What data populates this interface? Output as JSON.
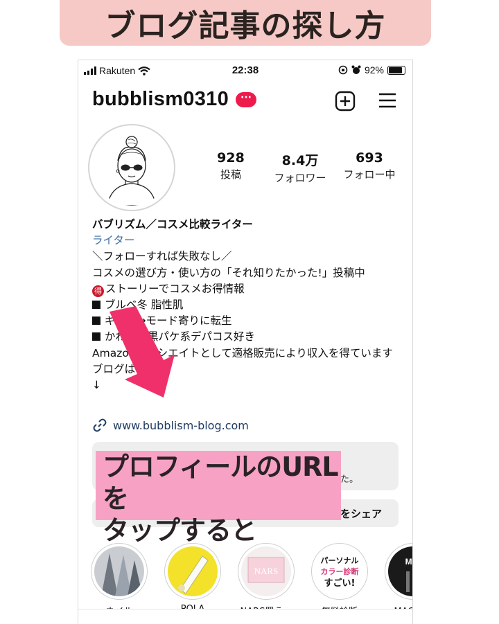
{
  "banner": {
    "title": "ブログ記事の探し方"
  },
  "status_bar": {
    "carrier": "Rakuten",
    "time": "22:38",
    "battery": "92%"
  },
  "profile": {
    "username": "bubblism0310",
    "more_badge": "···",
    "stats": [
      {
        "value": "928",
        "label": "投稿"
      },
      {
        "value": "8.4万",
        "label": "フォロワー"
      },
      {
        "value": "693",
        "label": "フォロー中"
      }
    ],
    "bio": {
      "name": "バブリズム／コスメ比較ライター",
      "category": "ライター",
      "line1": "＼フォローすれば失敗なし／",
      "line2": "コスメの選び方・使い方の「それ知りたかった!」投稿中",
      "line3_icon": "得",
      "line3": "ストーリーでコスメお得情報",
      "line4": "ブルベ冬 脂性肌",
      "line5": "ギャル→モード寄りに転生",
      "line6": "かわいい黒パケ系デパコス好き",
      "line7": "Amazonアソシエイトとして適格販売により収入を得ています",
      "line8": "ブログは↓",
      "line9": "↓"
    },
    "link": "www.bubblism-blog.com",
    "info_box_text": "た。",
    "share_button": "をシェア"
  },
  "overlay": {
    "line1": "プロフィールのURLを",
    "line2": "タップすると"
  },
  "highlights": [
    {
      "label": "ネイル"
    },
    {
      "label": "POLA"
    },
    {
      "label": "NARS買う…"
    },
    {
      "label": "無料診断"
    },
    {
      "label": "MAC購…"
    }
  ],
  "highlight_art": {
    "hl4_line1": "パーソナル",
    "hl4_line2": "カラー診断",
    "hl4_line3": "すごい!",
    "hl3_brand": "NARS",
    "hl5_brand": "M·A"
  },
  "colors": {
    "banner": "#f6c9c6",
    "accent_red": "#ed1b4c",
    "arrow": "#f0306a",
    "overlay": "#f7a2c4",
    "link": "#1e3b62"
  }
}
